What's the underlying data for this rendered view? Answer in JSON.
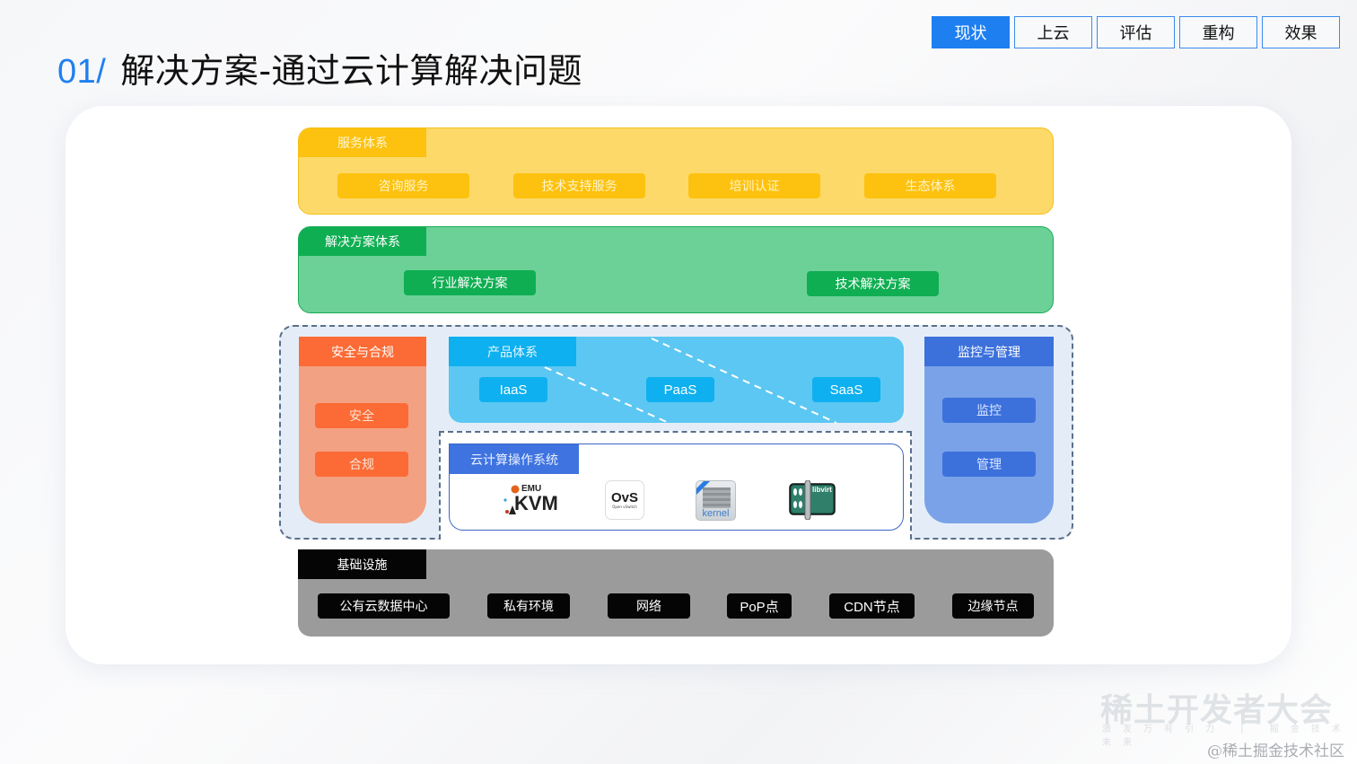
{
  "header": {
    "title_number": "01/",
    "title_text": "解决方案-通过云计算解决问题"
  },
  "tabs": [
    {
      "label": "现状",
      "active": true
    },
    {
      "label": "上云",
      "active": false
    },
    {
      "label": "评估",
      "active": false
    },
    {
      "label": "重构",
      "active": false
    },
    {
      "label": "效果",
      "active": false
    }
  ],
  "diagram": {
    "service_system": {
      "title": "服务体系",
      "items": [
        "咨询服务",
        "技术支持服务",
        "培训认证",
        "生态体系"
      ]
    },
    "solution_system": {
      "title": "解决方案体系",
      "items": [
        "行业解决方案",
        "技术解决方案"
      ]
    },
    "security_compliance": {
      "title": "安全与合规",
      "items": [
        "安全",
        "合规"
      ]
    },
    "product_system": {
      "title": "产品体系",
      "items": [
        "IaaS",
        "PaaS",
        "SaaS"
      ]
    },
    "cloud_os": {
      "title": "云计算操作系统",
      "logos": [
        {
          "name": "qemu-kvm",
          "label_top": "EMU",
          "label_main": "KVM"
        },
        {
          "name": "ovs",
          "label_main": "OvS",
          "label_sub": "Open vSwitch"
        },
        {
          "name": "kernel",
          "label_main": "kernel"
        },
        {
          "name": "libvirt",
          "label_main": "libvirt"
        }
      ]
    },
    "monitoring_management": {
      "title": "监控与管理",
      "items": [
        "监控",
        "管理"
      ]
    },
    "infrastructure": {
      "title": "基础设施",
      "items": [
        "公有云数据中心",
        "私有环境",
        "网络",
        "PoP点",
        "CDN节点",
        "边缘节点"
      ]
    }
  },
  "colors": {
    "accent": "#1e7ff0",
    "service": "#fdc20f",
    "solution": "#0fae52",
    "security": "#fc6b35",
    "product": "#0eb0ef",
    "cloud_os": "#3f74e0",
    "monitoring": "#3c71dc",
    "infrastructure": "#050505"
  },
  "watermark": {
    "event": "稀土开发者大会",
    "slogan": "激发万有引力 | 掘金技术未来",
    "community": "@稀土掘金技术社区"
  }
}
